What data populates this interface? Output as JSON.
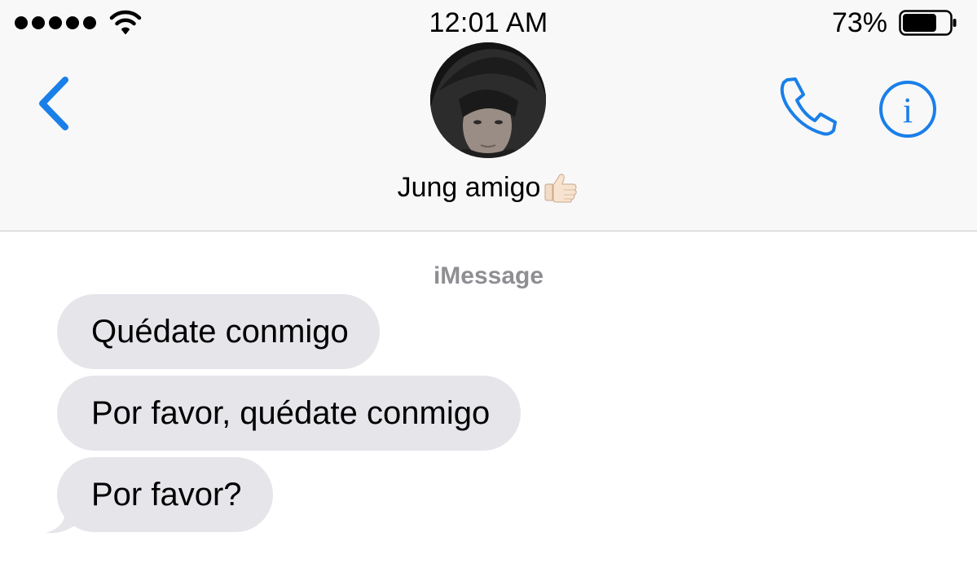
{
  "status_bar": {
    "time": "12:01 AM",
    "battery_percent": "73%",
    "battery_level": 0.73,
    "signal_bars": 5,
    "signal_icon": "signal-dots-icon",
    "wifi_icon": "wifi-icon",
    "battery_icon": "battery-icon"
  },
  "nav": {
    "back_icon": "chevron-left-icon",
    "call_icon": "phone-icon",
    "info_icon": "info-icon",
    "info_glyph": "i",
    "contact": {
      "name": "Jung amigo",
      "emoji_icon": "thumbs-up-emoji-icon"
    }
  },
  "conversation": {
    "service_label": "iMessage",
    "messages": [
      {
        "direction": "incoming",
        "text": "Quédate conmigo"
      },
      {
        "direction": "incoming",
        "text": "Por favor, quédate conmigo"
      },
      {
        "direction": "incoming",
        "text": "Por favor?"
      }
    ]
  },
  "colors": {
    "accent": "#1a7fe8",
    "bubble_incoming": "#e5e5ea",
    "header_background": "#f8f8f8",
    "label_gray": "#8e8e93",
    "divider": "#c6c6c8"
  }
}
